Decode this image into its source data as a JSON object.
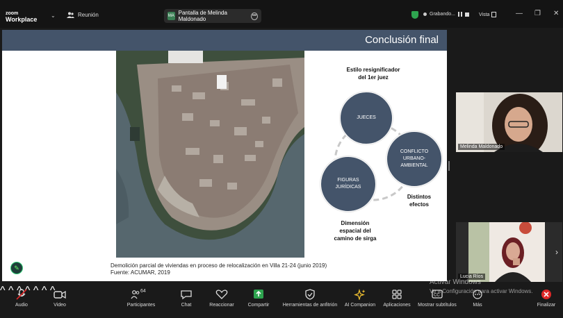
{
  "app": {
    "logo_line1": "zoom",
    "logo_line2": "Workplace"
  },
  "topbar": {
    "meeting_label": "Reunión",
    "share_label": "Pantalla de Melinda Maldonado",
    "recording_label": "Grabando...",
    "view_label": "Vista"
  },
  "slide": {
    "title": "Conclusión final",
    "label_top": [
      "Estilo resignificador",
      "del 1er juez"
    ],
    "circle_1": "JUECES",
    "circle_2": [
      "CONFLICTO",
      "URBANO-",
      "AMBIENTAL"
    ],
    "circle_3": [
      "FIGURAS",
      "JURÍDICAS"
    ],
    "label_effects": [
      "Distintos",
      "efectos"
    ],
    "label_bottom": [
      "Dimensión",
      "espacial del",
      "camino de sirga"
    ],
    "caption_1": "Demolición parcial de viviendas en proceso de relocalización en Villa 21-24 (junio 2019)",
    "caption_2": "Fuente: ACUMAR, 2019"
  },
  "participants": [
    {
      "name": "Melinda Maldonado"
    },
    {
      "name": "Lucia Ríos"
    }
  ],
  "toolbar": {
    "audio": "Audio",
    "video": "Video",
    "participants": "Participantes",
    "participants_count": "64",
    "chat": "Chat",
    "react": "Reaccionar",
    "share": "Compartir",
    "host_tools": "Herramientas de anfitrión",
    "ai": "AI Companion",
    "apps": "Aplicaciones",
    "subtitles": "Mostrar subtítulos",
    "more": "Más",
    "end": "Finalizar"
  },
  "watermark": {
    "line1": "Activar Windows",
    "line2": "Ve a Configuración para activar Windows."
  },
  "colors": {
    "slide_header": "#44546a",
    "circle": "#44546a",
    "shield": "#2ea44f",
    "end": "#e02828",
    "share": "#2ea44f"
  }
}
